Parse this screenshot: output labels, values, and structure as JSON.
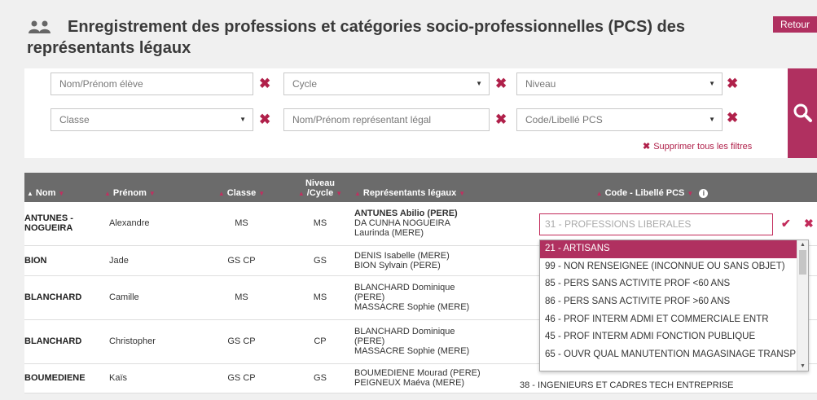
{
  "header": {
    "title_line1": "Enregistrement des professions et catégories socio-professionnelles (PCS) des",
    "title_line2": "représentants légaux",
    "back_label": "Retour",
    "icon": "users-icon"
  },
  "filters": {
    "nom_prenom_eleve": "Nom/Prénom élève",
    "cycle": "Cycle",
    "niveau": "Niveau",
    "classe": "Classe",
    "representant": "Nom/Prénom représentant légal",
    "code_pcs": "Code/Libellé PCS",
    "clear_all": "Supprimer tous les filtres",
    "search_icon": "search-icon"
  },
  "table": {
    "headers": {
      "nom": "Nom",
      "prenom": "Prénom",
      "classe": "Classe",
      "niveau_line1": "Niveau",
      "niveau_line2": "/Cycle",
      "representants": "Représentants légaux",
      "code_pcs": "Code - Libellé PCS"
    },
    "rows": [
      {
        "nom": "ANTUNES - NOGUEIRA",
        "prenom": "Alexandre",
        "classe": "MS",
        "niveau": "MS",
        "rep1": "ANTUNES Abilio (PERE)",
        "rep2": "DA CUNHA NOGUEIRA Laurinda (MERE)"
      },
      {
        "nom": "BION",
        "prenom": "Jade",
        "classe": "GS CP",
        "niveau": "GS",
        "rep1": "DENIS Isabelle (MERE)",
        "rep2": "BION Sylvain (PERE)"
      },
      {
        "nom": "BLANCHARD",
        "prenom": "Camille",
        "classe": "MS",
        "niveau": "MS",
        "rep1": "BLANCHARD Dominique (PERE)",
        "rep2": "MASSACRE Sophie (MERE)"
      },
      {
        "nom": "BLANCHARD",
        "prenom": "Christopher",
        "classe": "GS CP",
        "niveau": "CP",
        "rep1": "BLANCHARD Dominique (PERE)",
        "rep2": "MASSACRE Sophie (MERE)"
      },
      {
        "nom": "BOUMEDIENE",
        "prenom": "Kaïs",
        "classe": "GS CP",
        "niveau": "GS",
        "rep1": "BOUMEDIENE Mourad (PERE)",
        "rep2": "PEIGNEUX Maéva (MERE)",
        "pcs2": "38 - INGENIEURS ET CADRES TECH ENTREPRISE"
      }
    ]
  },
  "pcs_edit": {
    "placeholder": "31 - PROFESSIONS LIBERALES",
    "options": [
      "21 - ARTISANS",
      "99 - NON RENSEIGNEE (INCONNUE OU SANS OBJET)",
      "85 - PERS SANS ACTIVITE PROF <60 ANS",
      "86 - PERS SANS ACTIVITE PROF >60 ANS",
      "46 - PROF INTERM ADMI ET COMMERCIALE ENTR",
      "45 - PROF INTERM ADMI FONCTION PUBLIQUE",
      "65 - OUVR QUAL MANUTENTION MAGASINAGE TRANSP"
    ],
    "selected_index": 0
  },
  "colors": {
    "accent": "#b03060",
    "header_bg": "#6b6b6b"
  }
}
